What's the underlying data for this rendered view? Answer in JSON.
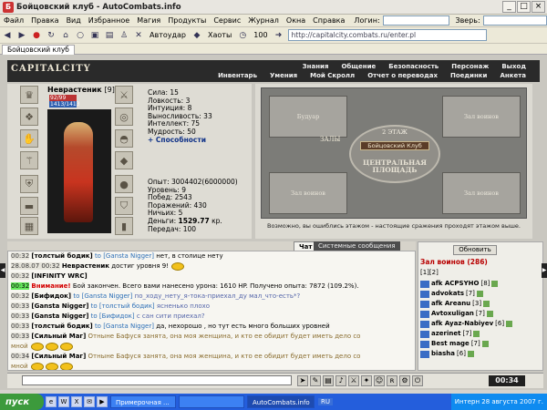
{
  "window": {
    "title": "Бойцовский клуб - AutoCombats.info"
  },
  "menu": {
    "items": [
      "Файл",
      "Правка",
      "Вид",
      "Избранное",
      "Магия",
      "Продукты",
      "Сервис",
      "Журнал",
      "Окна",
      "Справка"
    ],
    "login_label": "Логин:",
    "beast_label": "Зверь:"
  },
  "toolbar": {
    "autoattack": "Автоудар",
    "hotkeys": "Хаоты",
    "zoom": "100",
    "address": "http://capitalcity.combats.ru/enter.pl"
  },
  "tabs": {
    "active": "Бойцовский клуб"
  },
  "game": {
    "logo": "CAPITALCITY",
    "nav_top": [
      "Знания",
      "Общение",
      "Безопасность",
      "Персонаж",
      "Выход"
    ],
    "nav_bottom": [
      "Инвентарь",
      "Умения",
      "Мой Скролл",
      "Отчет о переводах",
      "Поединки",
      "Анкета"
    ]
  },
  "character": {
    "name": "Неврастеник",
    "level": "[9]",
    "hp": "92/99",
    "mp": "1413/1413",
    "stats": [
      "Сила: 15",
      "Ловкость: 3",
      "Интуиция: 8",
      "Выносливость: 33",
      "Интеллект: 75",
      "Мудрость: 50"
    ],
    "abilities_link": "+ Способности",
    "exp": "Опыт: 3004402(6000000)",
    "level_line": "Уровень: 9",
    "wins": "Побед: 2543",
    "losses": "Поражений: 430",
    "draws": "Ничьих: 5",
    "money_label": "Деньги:",
    "money_value": "1529.77",
    "money_unit": "кр.",
    "transfers": "Передач: 100"
  },
  "map": {
    "room_tl": "Будуар",
    "room_tr": "Зал воинов",
    "room_bl": "Зал воинов",
    "room_br": "Зал воинов",
    "floor": "2 ЭТАЖ",
    "enter_btn": "Бойцовский Клуб",
    "halls": "ЗАЛЫ",
    "plaza": "ЦЕНТРАЛЬНАЯ ПЛОЩАДЬ",
    "note": "Возможно, вы ошиблись этажом - настоящие сражения проходят этажом выше."
  },
  "chat": {
    "tab_chat": "Чат",
    "tab_system": "Системные сообщения",
    "lines": [
      {
        "time": "00:32",
        "nick": "[толстый бодик]",
        "pm": "to [Gansta Nigger]",
        "msg": "нет, в столице нету"
      },
      {
        "time": "28.08.07 00:32",
        "nick": "Неврастеник",
        "pm": "",
        "msg": "достиг уровня 9!"
      },
      {
        "time": "00:32",
        "nick": "[INFINITY WRC]",
        "pm": "",
        "msg": ""
      },
      {
        "time": "00:32",
        "nick": "",
        "pm": "",
        "msg": "Бой закончен. Всего вами нанесено урона: 1610 HP. Получено опыта: 7872 (109.2%)."
      },
      {
        "time": "00:32",
        "nick": "[Бифидок]",
        "pm": "to [Gansta Nigger]",
        "msg": "по_ходу_нету_я-тока-приехал_ду мал_что-есть*?"
      },
      {
        "time": "00:33",
        "nick": "[Gansta Nigger]",
        "pm": "to [толстый бодик]",
        "msg": "ясненько плохо"
      },
      {
        "time": "00:33",
        "nick": "[Gansta Nigger]",
        "pm": "to [Бифидок]",
        "msg": "с сан сити приехал?"
      },
      {
        "time": "00:33",
        "nick": "[толстый бодик]",
        "pm": "to [Gansta Nigger]",
        "msg": "да, нехорошо , но тут есть много больших уровней"
      },
      {
        "time": "00:33",
        "nick": "[Сильный Маг]",
        "pm": "",
        "msg": "Отныне Бафуся занята, она моя женщина, и кто ее обидит будет иметь дело со"
      },
      {
        "time": "",
        "nick": "",
        "pm": "",
        "msg": "мной"
      },
      {
        "time": "00:34",
        "nick": "[Сильный Маг]",
        "pm": "",
        "msg": "Отныне Бафуся занята, она моя женщина, и кто ее обидит будет иметь дело со"
      },
      {
        "time": "",
        "nick": "",
        "pm": "",
        "msg": "мной"
      }
    ],
    "sys_attention": "Внимание!"
  },
  "sidebar": {
    "refresh": "Обновить",
    "title": "Зал воинов (286)",
    "pages": "[1][2]",
    "players": [
      {
        "name": "afk ACPSYHO",
        "lvl": "[8]"
      },
      {
        "name": "advokats",
        "lvl": "[7]"
      },
      {
        "name": "afk Areanu",
        "lvl": "[3]"
      },
      {
        "name": "Avtoxuligan",
        "lvl": "[7]"
      },
      {
        "name": "afk Ayaz-Nabiyev",
        "lvl": "[6]"
      },
      {
        "name": "azerinet",
        "lvl": "[7]"
      },
      {
        "name": "Best mage",
        "lvl": "[7]"
      },
      {
        "name": "biasha",
        "lvl": "[6]"
      }
    ]
  },
  "bottom": {
    "clock": "00:34"
  },
  "taskbar": {
    "start": "пуск",
    "tasks": [
      "Примерочная ...",
      "",
      "AutoCombats.info"
    ],
    "lang": "RU",
    "tray_text": "Интерн 28 августа 2007 г."
  }
}
